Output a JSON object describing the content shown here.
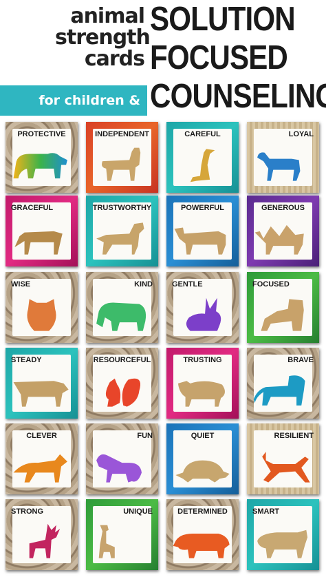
{
  "header": {
    "line1": "animal",
    "line2": "strength",
    "line3": "cards",
    "tag": "for children & teens",
    "title1": "SOLUTION",
    "title2": "FOCUSED",
    "title3": "COUNSELING"
  },
  "colors": {
    "teal": "#2fb6c1"
  },
  "cards": [
    {
      "label": "PROTECTIVE",
      "icon": "bear-icon"
    },
    {
      "label": "INDEPENDENT",
      "icon": "llama-icon"
    },
    {
      "label": "CAREFUL",
      "icon": "meerkat-icon"
    },
    {
      "label": "LOYAL",
      "icon": "horse-icon"
    },
    {
      "label": "GRACEFUL",
      "icon": "deer-icon"
    },
    {
      "label": "TRUSTWORTHY",
      "icon": "wolf-icon"
    },
    {
      "label": "POWERFUL",
      "icon": "bull-icon"
    },
    {
      "label": "GENEROUS",
      "icon": "camel-icon"
    },
    {
      "label": "WISE",
      "icon": "owl-icon"
    },
    {
      "label": "KIND",
      "icon": "elephant-icon"
    },
    {
      "label": "GENTLE",
      "icon": "rabbit-icon"
    },
    {
      "label": "FOCUSED",
      "icon": "tiger-icon"
    },
    {
      "label": "STEADY",
      "icon": "cow-icon"
    },
    {
      "label": "RESOURCEFUL",
      "icon": "squirrel-icon"
    },
    {
      "label": "TRUSTING",
      "icon": "sheep-icon"
    },
    {
      "label": "BRAVE",
      "icon": "lion-icon"
    },
    {
      "label": "CLEVER",
      "icon": "fox-icon"
    },
    {
      "label": "FUN",
      "icon": "monkey-icon"
    },
    {
      "label": "QUIET",
      "icon": "turtle-icon"
    },
    {
      "label": "RESILIENT",
      "icon": "antelope-icon"
    },
    {
      "label": "STRONG",
      "icon": "stag-icon"
    },
    {
      "label": "UNIQUE",
      "icon": "giraffe-icon"
    },
    {
      "label": "DETERMINED",
      "icon": "rhino-icon"
    },
    {
      "label": "SMART",
      "icon": "pig-icon"
    }
  ]
}
